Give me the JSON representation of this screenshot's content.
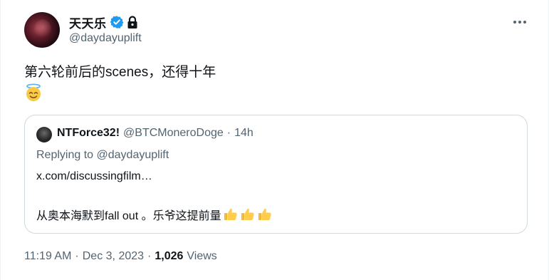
{
  "author": {
    "display_name": "天天乐",
    "handle": "@daydayuplift",
    "verified": true,
    "protected": true,
    "icons": {
      "verified": "verified-badge-icon",
      "lock": "lock-icon",
      "more": "more-icon"
    },
    "accent_color": "#1d9bf0"
  },
  "tweet": {
    "text": "第六轮前后的scenes，还得十年",
    "emoji": "smiling-face-with-halo"
  },
  "quote": {
    "display_name": "NTForce32!",
    "handle": "@BTCMoneroDoge",
    "separator": "·",
    "time": "14h",
    "replying_to_prefix": "Replying to",
    "replying_to_handle": "@daydayuplift",
    "link": "x.com/discussingfilm…",
    "body_text": "从奥本海默到fall out 。乐爷这提前量",
    "body_emoji": [
      "thumbs-up",
      "thumbs-up",
      "thumbs-up"
    ]
  },
  "meta": {
    "time": "11:19 AM",
    "sep1": "·",
    "date": "Dec 3, 2023",
    "sep2": "·",
    "views_count": "1,026",
    "views_label": "Views"
  }
}
